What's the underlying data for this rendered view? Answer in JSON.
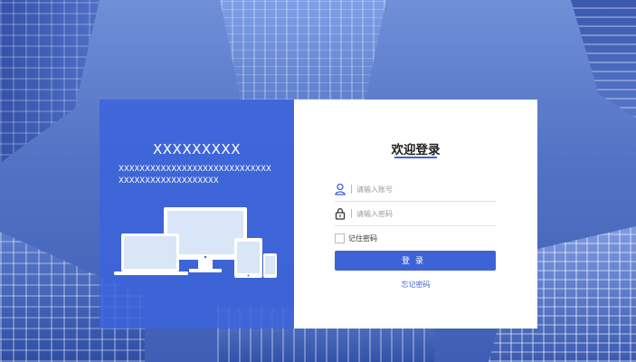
{
  "left_panel": {
    "brand": "XXXXXXXXX",
    "description": "XXXXXXXXXXXXXXXXXXXXXXXXXXXXXXXXXXXXXXXXXXXXXXXX",
    "illustration": "devices-illustration"
  },
  "login": {
    "title": "欢迎登录",
    "username_placeholder": "请输入账号",
    "username_value": "",
    "password_placeholder": "请输入密码",
    "password_value": "",
    "remember_label": "记住密码",
    "remember_checked": false,
    "submit_label": "登录",
    "forgot_label": "忘记密码",
    "icons": [
      "user-icon",
      "lock-icon"
    ]
  },
  "colors": {
    "accent": "#3d63d6",
    "left_panel_bg": "#3c64dc",
    "background": "#5272c4"
  }
}
